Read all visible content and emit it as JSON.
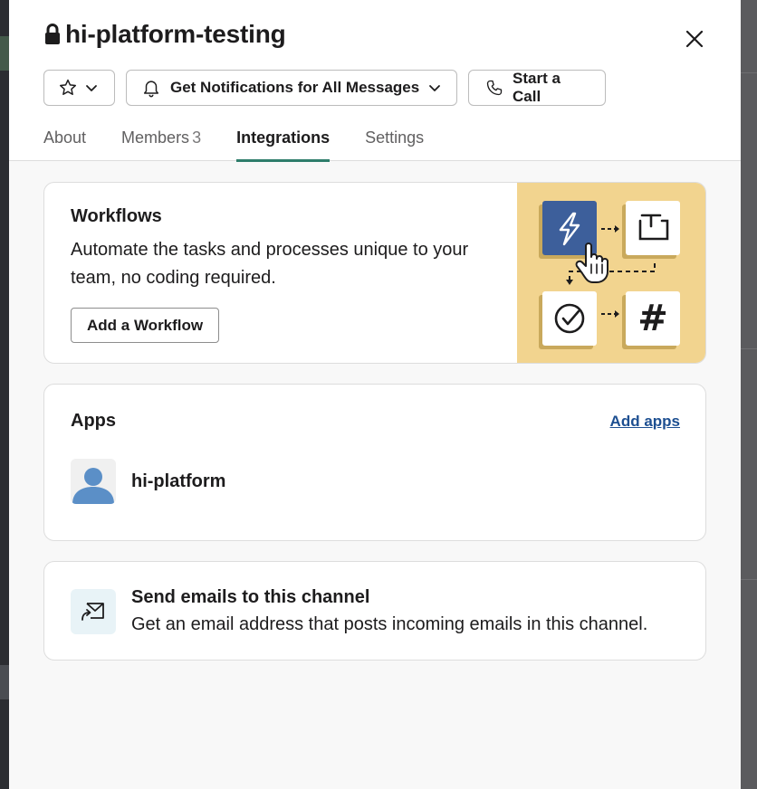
{
  "header": {
    "channel_name": "hi-platform-testing",
    "close_label": "Close"
  },
  "buttons": {
    "notifications_label": "Get Notifications for All Messages",
    "call_label": "Start a Call"
  },
  "tabs": [
    {
      "label": "About"
    },
    {
      "label": "Members",
      "count": "3"
    },
    {
      "label": "Integrations"
    },
    {
      "label": "Settings"
    }
  ],
  "active_tab": "Integrations",
  "workflows": {
    "title": "Workflows",
    "description": "Automate the tasks and processes unique to your team, no coding required.",
    "button_label": "Add a Workflow",
    "illustration_symbol": "#"
  },
  "apps": {
    "title": "Apps",
    "add_label": "Add apps",
    "items": [
      {
        "name": "hi-platform"
      }
    ]
  },
  "email": {
    "title": "Send emails to this channel",
    "description": "Get an email address that posts incoming emails in this channel."
  },
  "colors": {
    "accent_tab": "#2e7d6b",
    "workflow_bg": "#f2d48f",
    "workflow_tile": "#3d5f9b",
    "link": "#1d4f91",
    "avatar": "#5b8fc7"
  },
  "icons": {
    "lock": "lock-icon",
    "close": "close-icon",
    "star": "star-icon",
    "bell": "bell-icon",
    "phone": "phone-icon",
    "chevron": "chevron-down-icon",
    "email": "email-forward-icon"
  }
}
